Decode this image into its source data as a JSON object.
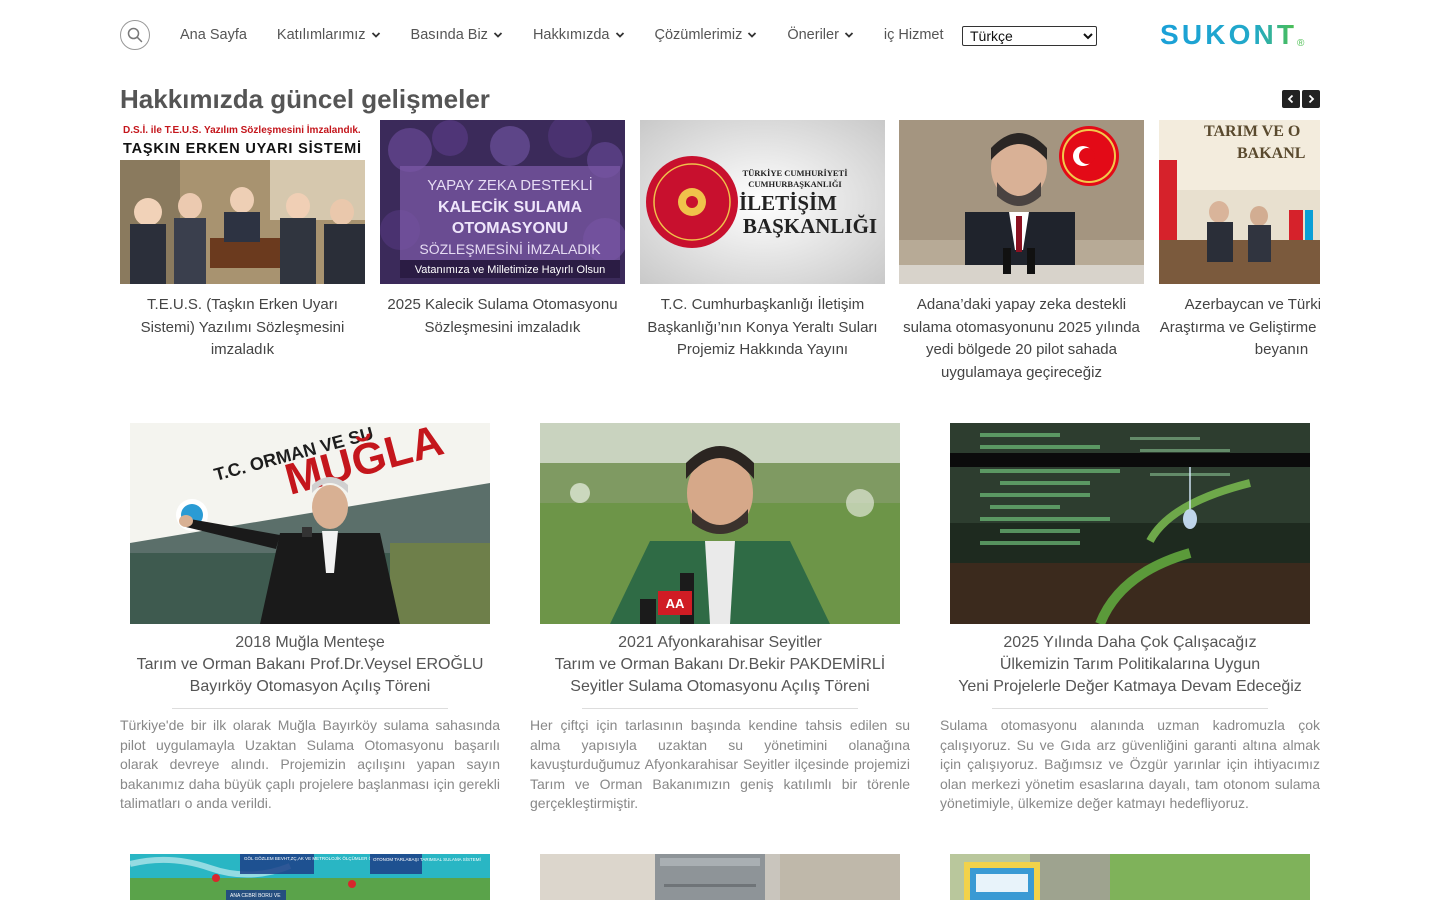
{
  "header": {
    "nav": [
      {
        "label": "Ana Sayfa",
        "dropdown": false
      },
      {
        "label": "Katılımlarımız",
        "dropdown": true
      },
      {
        "label": "Basında Biz",
        "dropdown": true
      },
      {
        "label": "Hakkımızda",
        "dropdown": true
      },
      {
        "label": "Çözümlerimiz",
        "dropdown": true
      },
      {
        "label": "Öneriler",
        "dropdown": true
      },
      {
        "label": "iç Hizmet",
        "dropdown": false
      }
    ],
    "language": "Türkçe",
    "logo_text": "SUKONT",
    "logo_mark": "®",
    "colors": {
      "logo_blue": "#1c9fd6",
      "logo_green": "#5cbf3c"
    }
  },
  "news": {
    "title": "Hakkımızda güncel gelişmeler",
    "items": [
      {
        "caption": "T.E.U.S. (Taşkın Erken Uyarı Sistemi) Yazılımı Sözleşmesini imzaladık",
        "image_text_1": "D.S.İ. ile T.E.U.S. Yazılım Sözleşmesini İmzalandık.",
        "image_text_2": "TAŞKIN ERKEN UYARI SİSTEMİ"
      },
      {
        "caption": "2025 Kalecik Sulama Otomasyonu Sözleşmesini imzaladık",
        "image_lines": [
          "YAPAY ZEKA DESTEKLİ",
          "KALECİK SULAMA",
          "OTOMASYONU",
          "SÖZLEŞMESİNİ İMZALADIK"
        ],
        "image_footer": "Vatanımıza ve Milletimize Hayırlı Olsun"
      },
      {
        "caption": "T.C. Cumhurbaşkanlığı İletişim Başkanlığı’nın Konya Yeraltı Suları Projemiz Hakkında Yayını",
        "image_small_1": "TÜRKİYE CUMHURİYETİ",
        "image_small_2": "CUMHURBAŞKANLIĞI",
        "image_big_1": "İLETİŞİM",
        "image_big_2": "BAŞKANLIĞI"
      },
      {
        "caption": "Adana’daki yapay zeka destekli sulama otomasyonunu 2025 yılında yedi bölgede 20 pilot sahada uygulamaya geçireceğiz"
      },
      {
        "caption": "Azerbaycan ve Türkiye Tarım Araştırma ve Geliştirme İşbirliği niyet beyanın",
        "image_text_1": "TARIM VE O",
        "image_text_2": "BAKANL"
      }
    ]
  },
  "cards": [
    {
      "title_lines": [
        "2018 Muğla Menteşe",
        "Tarım ve Orman Bakanı Prof.Dr.Veysel EROĞLU",
        "Bayırköy Otomasyon Açılış Töreni"
      ],
      "description": "Türkiye'de bir ilk olarak Muğla Bayırköy sulama sahasında pilot uygulamayla Uzaktan Sulama Otomasyonu başarılı olarak devreye alındı. Projemizin açılışını yapan sayın bakanımız daha büyük çaplı projelere başlanması için gerekli talimatları o anda verildi.",
      "image_text_1": "T.C. ORMAN VE SU",
      "image_text_2": "MUĞLA"
    },
    {
      "title_lines": [
        "2021 Afyonkarahisar Seyitler",
        "Tarım ve Orman Bakanı Dr.Bekir PAKDEMİRLİ",
        "Seyitler Sulama Otomasyonu Açılış Töreni"
      ],
      "description": "Her çiftçi için tarlasının başında kendine tahsis edilen su alma yapısıyla uzaktan su yönetimini olanağına kavuşturduğumuz Afyonkarahisar Seyitler ilçesinde projemizi Tarım ve Orman Bakanımızın geniş katılımlı bir törenle gerçekleştirmiştir.",
      "mic_label": "AA"
    },
    {
      "title_lines": [
        "2025 Yılında Daha Çok Çalışacağız",
        "Ülkemizin Tarım Politikalarına Uygun",
        "Yeni Projelerle Değer Katmaya Devam Edeceğiz"
      ],
      "description": "Sulama otomasyonu alanında uzman kadromuzla çok çalışıyoruz. Su ve Gıda arz güvenliğini garanti altına almak için çalışıyoruz. Bağımsız ve Özgür yarınlar için ihtiyacımız olan merkezi yönetim esaslarına dayalı, tam otonom sulama yönetimiyle, ülkemize değer katmayı hedefliyoruz."
    }
  ],
  "bottom_thumbs": [
    {
      "labels": [
        "GÖL GÖZLEM BEVHT,ZÇ,AK VE METROLOJİK ÖLÇÜMLER ÖLÇÜM İSTASYONU",
        "OTONOM TARLABAŞI TARIMSAL SULAMA SİSTEMİ",
        "ANA CEBRİ BORU VE"
      ]
    },
    {
      "labels": []
    },
    {
      "labels": []
    }
  ]
}
